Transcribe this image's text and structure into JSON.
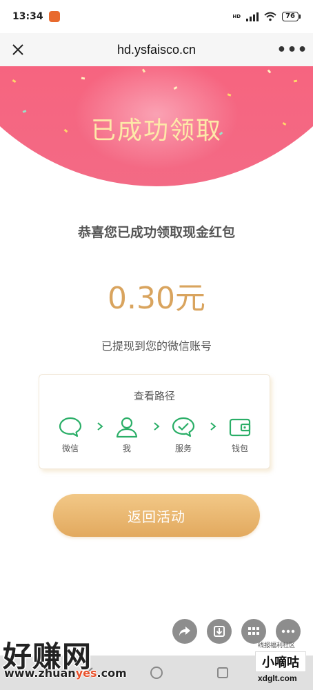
{
  "status_bar": {
    "time": "13:34",
    "network": "HD",
    "battery": "76"
  },
  "nav_bar": {
    "url": "hd.ysfaisco.cn",
    "more": "•••"
  },
  "banner": {
    "title": "已成功领取"
  },
  "main": {
    "congrats": "恭喜您已成功领取现金红包",
    "amount": "0.30元",
    "withdrawn_text": "已提现到您的微信账号"
  },
  "path_card": {
    "title": "查看路径",
    "steps": [
      {
        "label": "微信",
        "icon": "chat-bubble-icon"
      },
      {
        "label": "我",
        "icon": "user-icon"
      },
      {
        "label": "服务",
        "icon": "check-bubble-icon"
      },
      {
        "label": "钱包",
        "icon": "wallet-icon"
      }
    ]
  },
  "return_button": {
    "label": "返回活动"
  },
  "watermark": {
    "left_big": "好赚网",
    "left_small_prefix": "www.zhuan",
    "left_small_highlight": "yes",
    "left_small_suffix": ".com",
    "right_top": "线报福利社区",
    "right_brand": "小嘀咕",
    "right_url": "xdglt.com"
  },
  "colors": {
    "banner_pink": "#f2486f",
    "title_gold": "#fde9a8",
    "amount_gold": "#d9a45e",
    "wechat_green": "#2aae67",
    "button_gold": "#e2a95e"
  }
}
